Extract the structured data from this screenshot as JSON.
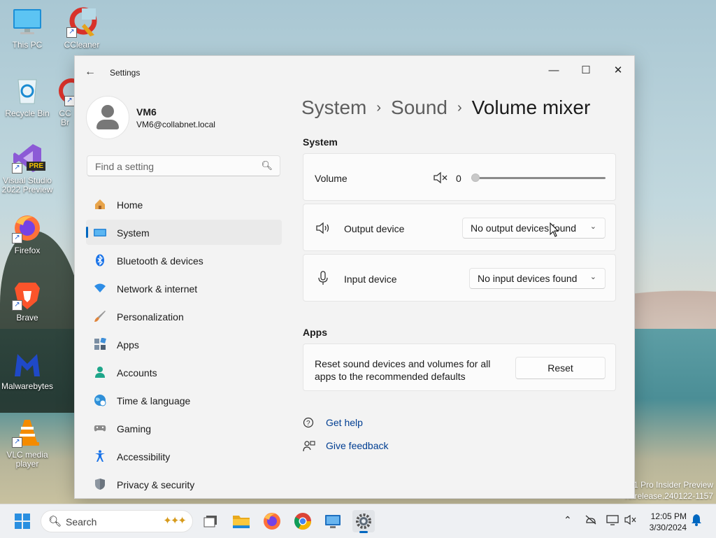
{
  "desktop": {
    "icons": [
      {
        "label": "This PC",
        "icon": "monitor-icon"
      },
      {
        "label": "CCleaner",
        "icon": "ccleaner-icon"
      },
      {
        "label": "Recycle Bin",
        "icon": "recycle-bin-icon"
      },
      {
        "label": "CC Br",
        "icon": "ccleaner-browser-icon"
      },
      {
        "label": "Visual Studio 2022 Preview",
        "icon": "visual-studio-icon",
        "badge": "PRE"
      },
      {
        "label": "Firefox",
        "icon": "firefox-icon"
      },
      {
        "label": "Brave",
        "icon": "brave-icon"
      },
      {
        "label": "Malwarebytes",
        "icon": "malwarebytes-icon"
      },
      {
        "label": "VLC media player",
        "icon": "vlc-icon"
      }
    ],
    "watermark_line1": "1 Pro Insider Preview",
    "watermark_line2": "relrelease.240122-1157"
  },
  "window": {
    "title": "Settings",
    "back_glyph": "←",
    "minimize_glyph": "—",
    "maximize_glyph": "☐",
    "close_glyph": "✕"
  },
  "profile": {
    "name": "VM6",
    "email": "VM6@collabnet.local"
  },
  "search": {
    "placeholder": "Find a setting"
  },
  "nav": {
    "items": [
      {
        "label": "Home",
        "icon": "home-icon",
        "active": false
      },
      {
        "label": "System",
        "icon": "system-icon",
        "active": true
      },
      {
        "label": "Bluetooth & devices",
        "icon": "bluetooth-icon",
        "active": false
      },
      {
        "label": "Network & internet",
        "icon": "wifi-icon",
        "active": false
      },
      {
        "label": "Personalization",
        "icon": "brush-icon",
        "active": false
      },
      {
        "label": "Apps",
        "icon": "apps-icon",
        "active": false
      },
      {
        "label": "Accounts",
        "icon": "accounts-icon",
        "active": false
      },
      {
        "label": "Time & language",
        "icon": "globe-clock-icon",
        "active": false
      },
      {
        "label": "Gaming",
        "icon": "gamepad-icon",
        "active": false
      },
      {
        "label": "Accessibility",
        "icon": "accessibility-icon",
        "active": false
      },
      {
        "label": "Privacy & security",
        "icon": "shield-icon",
        "active": false
      }
    ]
  },
  "breadcrumb": {
    "items": [
      "System",
      "Sound",
      "Volume mixer"
    ],
    "separator": "›"
  },
  "system_section": {
    "heading": "System",
    "volume": {
      "label": "Volume",
      "value": "0",
      "level": 0
    },
    "output": {
      "label": "Output device",
      "selected": "No output devices found"
    },
    "input": {
      "label": "Input device",
      "selected": "No input devices found"
    }
  },
  "apps_section": {
    "heading": "Apps",
    "reset_text_line1": "Reset sound devices and volumes for all",
    "reset_text_line2": "apps to the recommended defaults",
    "reset_button": "Reset"
  },
  "links": {
    "help": "Get help",
    "feedback": "Give feedback"
  },
  "taskbar": {
    "search_label": "Search",
    "time": "12:05 PM",
    "date": "3/30/2024",
    "pinned": [
      "start-icon",
      "task-view-icon",
      "file-explorer-icon",
      "firefox-icon",
      "chrome-icon",
      "remote-desktop-icon",
      "settings-icon"
    ],
    "active": "settings-icon"
  },
  "colors": {
    "accent": "#0067c0",
    "link": "#003e92",
    "window_bg": "#f3f3f3",
    "card_bg": "#fbfbfb"
  }
}
